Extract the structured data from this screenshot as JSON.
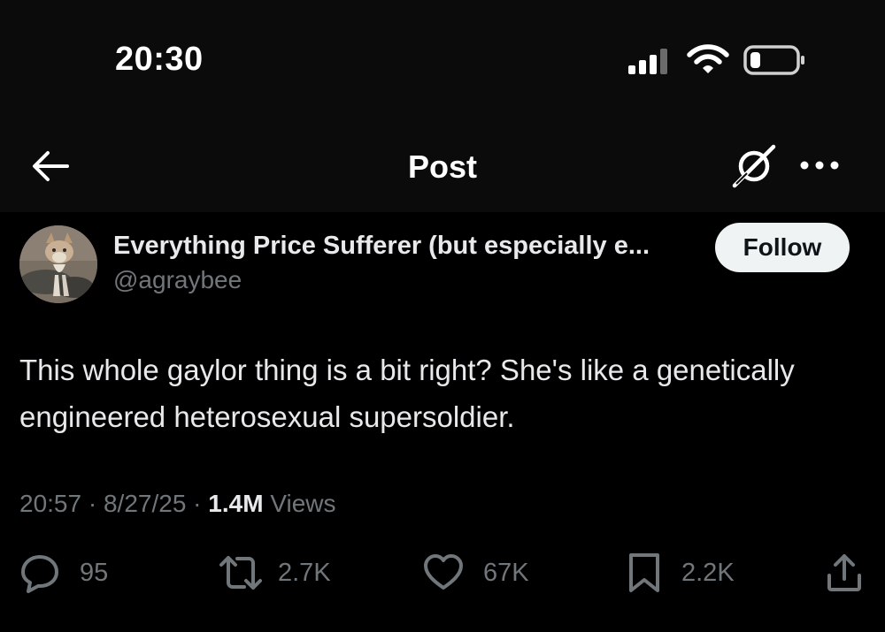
{
  "status_bar": {
    "time": "20:30",
    "icons": [
      "cellular-signal-icon",
      "wifi-icon",
      "battery-icon"
    ]
  },
  "nav": {
    "title": "Post",
    "icons": [
      "back-arrow-icon",
      "grok-icon",
      "more-icon"
    ]
  },
  "post": {
    "author": {
      "name": "Everything Price Sufferer (but especially e...",
      "handle": "@agraybee"
    },
    "follow_label": "Follow",
    "text": "This whole gaylor thing is a bit right? She's like a genetically engineered heterosexual supersoldier.",
    "time": "20:57",
    "separator": "·",
    "date": "8/27/25",
    "views_count": "1.4M",
    "views_label": "Views"
  },
  "actions": {
    "replies": "95",
    "reposts": "2.7K",
    "likes": "67K",
    "bookmarks": "2.2K"
  },
  "colors": {
    "background": "#000000",
    "top_bar": "#0b0b0b",
    "text_primary": "#e7e9ea",
    "text_secondary": "#71767b",
    "follow_bg": "#eff3f4",
    "follow_text": "#0f1419"
  }
}
